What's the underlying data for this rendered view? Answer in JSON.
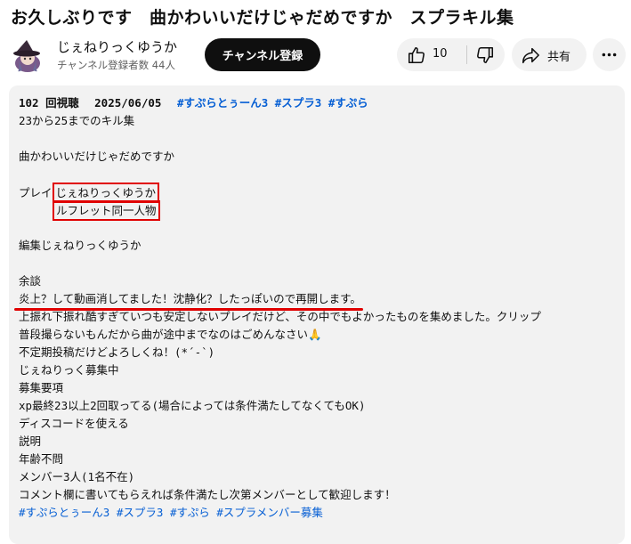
{
  "video": {
    "title": "お久しぶりです　曲かわいいだけじゃだめですか　スプラキル集"
  },
  "channel": {
    "name": "じぇねりっくゆうか",
    "subscribers": "チャンネル登録者数 44人",
    "subscribe_label": "チャンネル登録"
  },
  "actions": {
    "like_count": "10",
    "share_label": "共有"
  },
  "description": {
    "views": "102 回視聴",
    "date": "2025/06/05",
    "meta_tags": [
      "#すぷらとぅーん3",
      "#スプラ3",
      "#すぷら"
    ],
    "lines": {
      "l1": "23から25までのキル集",
      "l3": "曲かわいいだけじゃだめですか",
      "play_label": "プレイ",
      "play_1": "じぇねりっくゆうか",
      "play_2": "ルフレット同一人物",
      "edit": "編集じぇねりっくゆうか",
      "aside": "余談",
      "underlined": "炎上？して動画消してました！沈静化？したっぽいので再開します。",
      "l_a": "上振れ下振れ酷すぎていつも安定しないプレイだけど、その中でもよかったものを集めました。クリップ",
      "l_b": "普段撮らないもんだから曲が途中までなのはごめんなさい🙏",
      "l_c": "不定期投稿だけどよろしくね！(*´-`)",
      "l_d": "じぇねりっく募集中",
      "l_e": "募集要項",
      "l_f": "xp最終23以上2回取ってる(場合によっては条件満たしてなくてもOK)",
      "l_g": "ディスコードを使える",
      "l_h": "説明",
      "l_i": "年齢不問",
      "l_j": "メンバー3人(1名不在)",
      "l_k": "コメント欄に書いてもらえれば条件満たし次第メンバーとして歓迎します！"
    },
    "footer_tags": [
      "#すぷらとぅーん3",
      "#スプラ3",
      "#すぷら",
      "#スプラメンバー募集"
    ]
  },
  "colors": {
    "link": "#065fd4",
    "annotation_red": "#e00000",
    "panel_bg": "#f2f2f2"
  },
  "icons": [
    "avatar-witch-icon",
    "thumbs-up-icon",
    "thumbs-down-icon",
    "share-icon",
    "more-dots-icon"
  ]
}
